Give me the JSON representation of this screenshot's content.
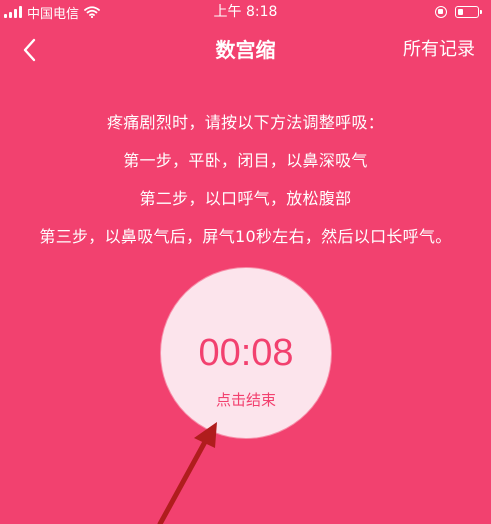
{
  "status_bar": {
    "carrier": "中国电信",
    "time": "上午 8:18",
    "signal_icon": "signal-bars-icon",
    "wifi_icon": "wifi-icon",
    "rotation_lock_icon": "rotation-lock-icon",
    "battery_icon": "battery-icon"
  },
  "nav": {
    "back_icon": "chevron-left-icon",
    "title": "数宫缩",
    "right_link": "所有记录"
  },
  "instructions": {
    "intro": "疼痛剧烈时，请按以下方法调整呼吸：",
    "steps": [
      "第一步，平卧，闭目，以鼻深吸气",
      "第二步，以口呼气，放松腹部",
      "第三步，以鼻吸气后，屏气10秒左右，然后以口长呼气。"
    ]
  },
  "timer": {
    "value": "00:08",
    "action_label": "点击结束"
  },
  "annotation": {
    "arrow_icon": "pointer-arrow-icon",
    "arrow_color": "#b01d1d"
  },
  "colors": {
    "background": "#f2416f",
    "circle": "#fce4ec",
    "accent_text": "#f2416f"
  }
}
